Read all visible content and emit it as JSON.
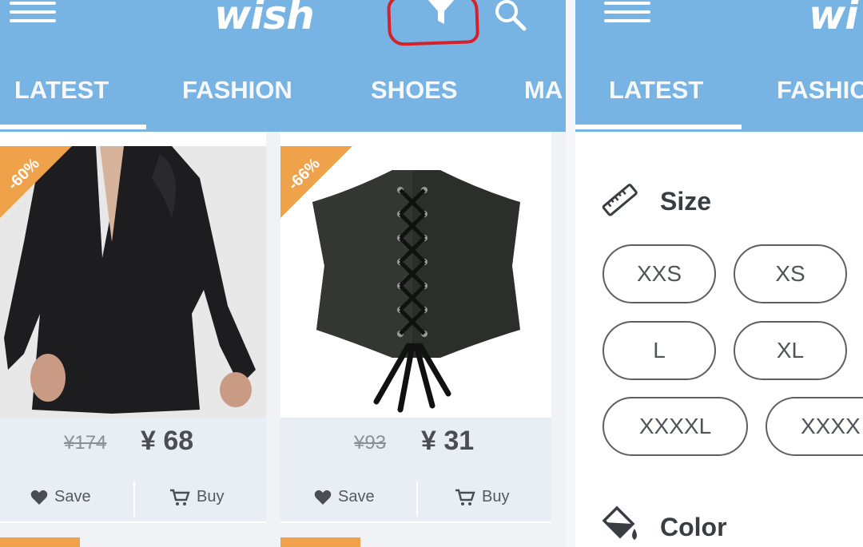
{
  "left": {
    "app_logo": "wish",
    "tabs": [
      "LATEST",
      "FASHION",
      "SHOES",
      "MA"
    ],
    "active_tab": "LATEST",
    "products": [
      {
        "badge": "-60%",
        "old_price": "¥174",
        "price": "¥ 68",
        "save_label": "Save",
        "buy_label": "Buy"
      },
      {
        "badge": "-66%",
        "old_price": "¥93",
        "price": "¥ 31",
        "save_label": "Save",
        "buy_label": "Buy"
      }
    ]
  },
  "right": {
    "app_logo": "wi",
    "tabs": [
      "LATEST",
      "FASHIO"
    ],
    "filter": {
      "size_title": "Size",
      "sizes": [
        "XXS",
        "XS",
        "L",
        "XL",
        "XXXXL",
        "XXXX"
      ],
      "color_title": "Color"
    }
  },
  "colors": {
    "appbar": "#77b4e3",
    "badge": "#f0a24a",
    "filter_highlight": "#d8202a"
  },
  "icons": [
    "menu-icon",
    "filter-icon",
    "search-icon",
    "heart-icon",
    "cart-icon",
    "ruler-icon",
    "paint-bucket-icon"
  ]
}
